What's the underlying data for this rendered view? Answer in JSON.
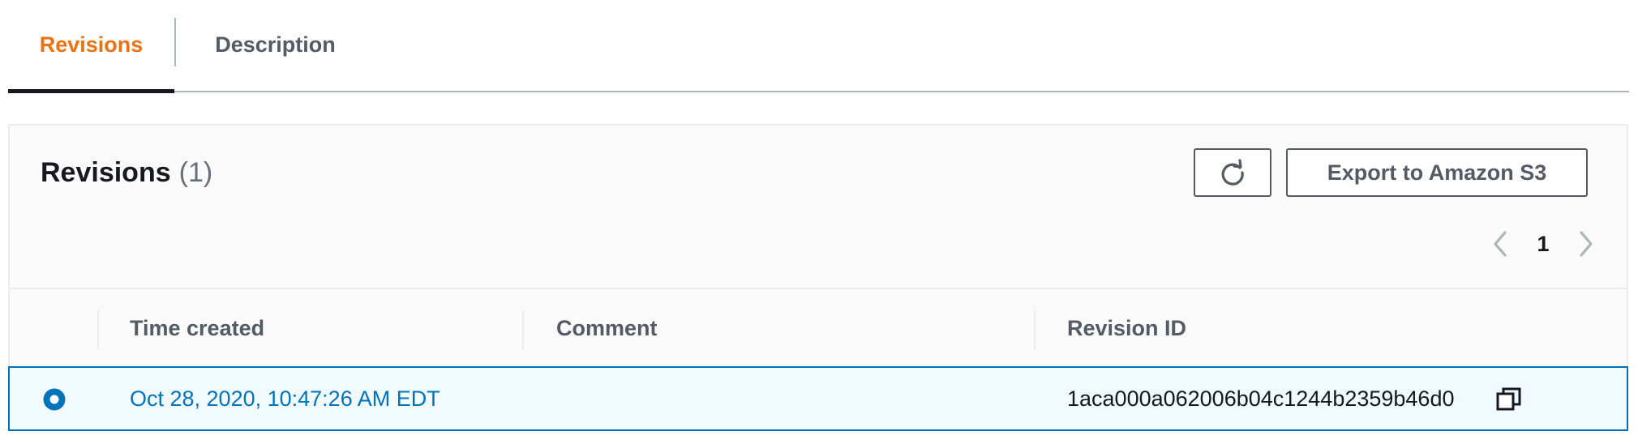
{
  "tabs": [
    {
      "label": "Revisions",
      "active": true
    },
    {
      "label": "Description",
      "active": false
    }
  ],
  "panel": {
    "title": "Revisions",
    "count": "(1)",
    "refresh_icon": "refresh-icon",
    "export_label": "Export to Amazon S3"
  },
  "pagination": {
    "current_page": "1",
    "prev_icon": "chevron-left-icon",
    "next_icon": "chevron-right-icon"
  },
  "table": {
    "columns": [
      "Time created",
      "Comment",
      "Revision ID"
    ],
    "rows": [
      {
        "selected": true,
        "time_created": "Oct 28, 2020, 10:47:26 AM EDT",
        "comment": "",
        "revision_id": "1aca000a062006b04c1244b2359b46d0",
        "copy_icon": "copy-icon"
      }
    ]
  },
  "colors": {
    "accent_orange": "#ec7211",
    "link_blue": "#0073bb",
    "selected_row_bg": "#f1faff",
    "border_gray": "#aab7b8",
    "text_dark": "#16191f",
    "text_muted": "#545b64"
  }
}
